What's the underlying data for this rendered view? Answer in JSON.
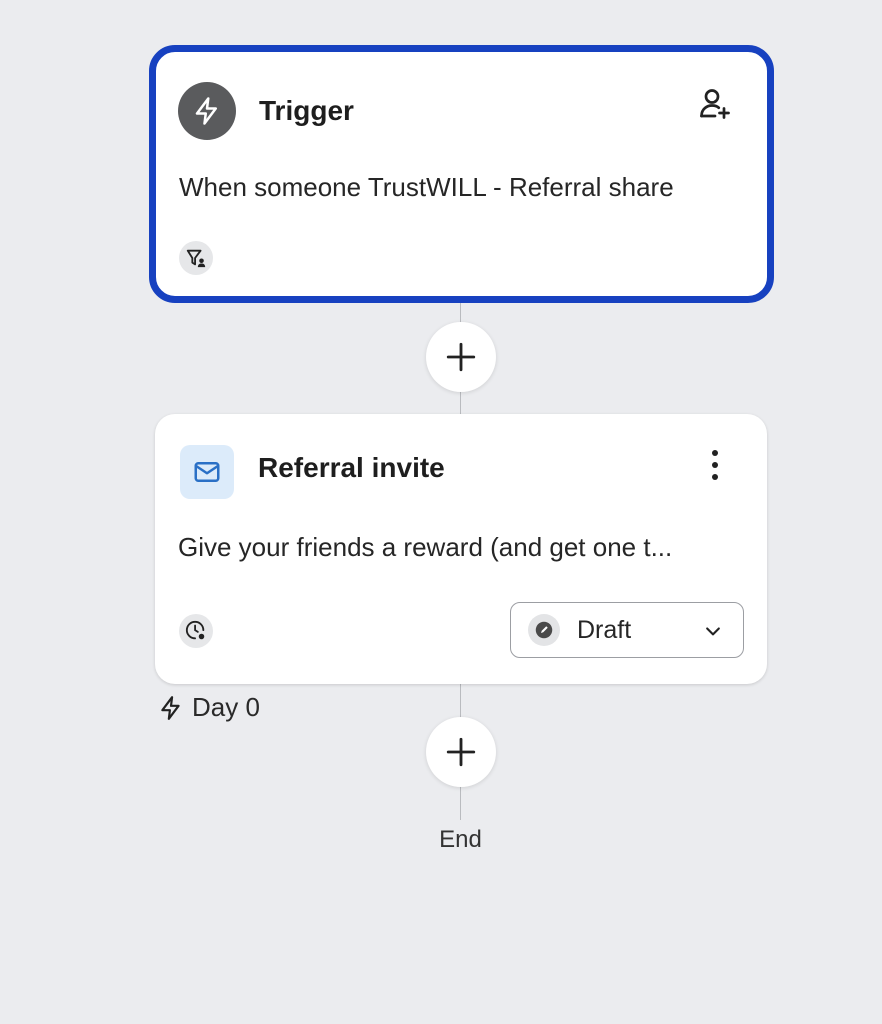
{
  "trigger": {
    "title": "Trigger",
    "description": "When someone TrustWILL - Referral share",
    "icons": {
      "badge": "lightning-icon",
      "action": "add-person-icon",
      "filter": "filter-person-icon"
    }
  },
  "email_step": {
    "title": "Referral invite",
    "description": "Give your friends a reward (and get one t...",
    "status": "Draft",
    "icons": {
      "badge": "mail-icon",
      "menu": "kebab-menu-icon",
      "schedule": "clock-settings-icon",
      "status": "pencil-icon",
      "dropdown": "chevron-down-icon"
    }
  },
  "delay": {
    "label": "Day 0",
    "icon": "lightning-outline-icon"
  },
  "end": {
    "label": "End"
  },
  "colors": {
    "accent_border": "#1741c0",
    "background": "#ebecef",
    "mail_badge": "#dcebfa"
  }
}
